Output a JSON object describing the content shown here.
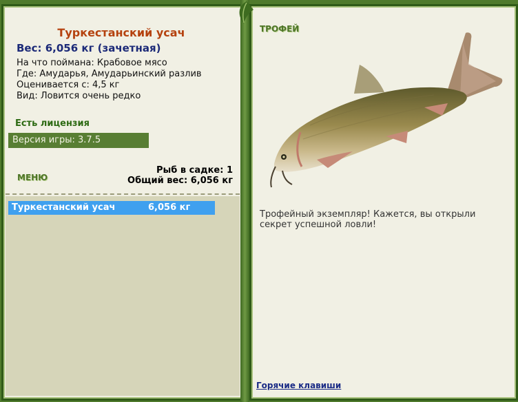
{
  "fish": {
    "title": "Туркестанский усач",
    "weight": "Вес: 6,056 кг (зачетная)",
    "bait": "На что поймана: Крабовое мясо",
    "place": "Где: Амударья, Амударьинский разлив",
    "price": "Оценивается с: 4,5 кг",
    "kind": "Вид: Ловится очень редко"
  },
  "license": "Есть лицензия",
  "version": "Версия игры: 3.7.5",
  "menu_label": "МЕНЮ",
  "cage": {
    "count": "Рыб в садке: 1",
    "total": "Общий вес: 6,056 кг"
  },
  "list": [
    {
      "name": "Туркестанский усач",
      "weight": "6,056 кг"
    }
  ],
  "trophy": {
    "label": "ТРОФЕЙ",
    "text": "Трофейный экземпляр! Кажется, вы открыли секрет успешной ловли!"
  },
  "hotkeys": "Горячие клавиши",
  "colors": {
    "frame_green": "#4f7a2c",
    "panel_bg": "#f1f0e4",
    "title_orange": "#b5420f",
    "weight_navy": "#1c2a78",
    "list_selected": "#3fa0ef"
  }
}
